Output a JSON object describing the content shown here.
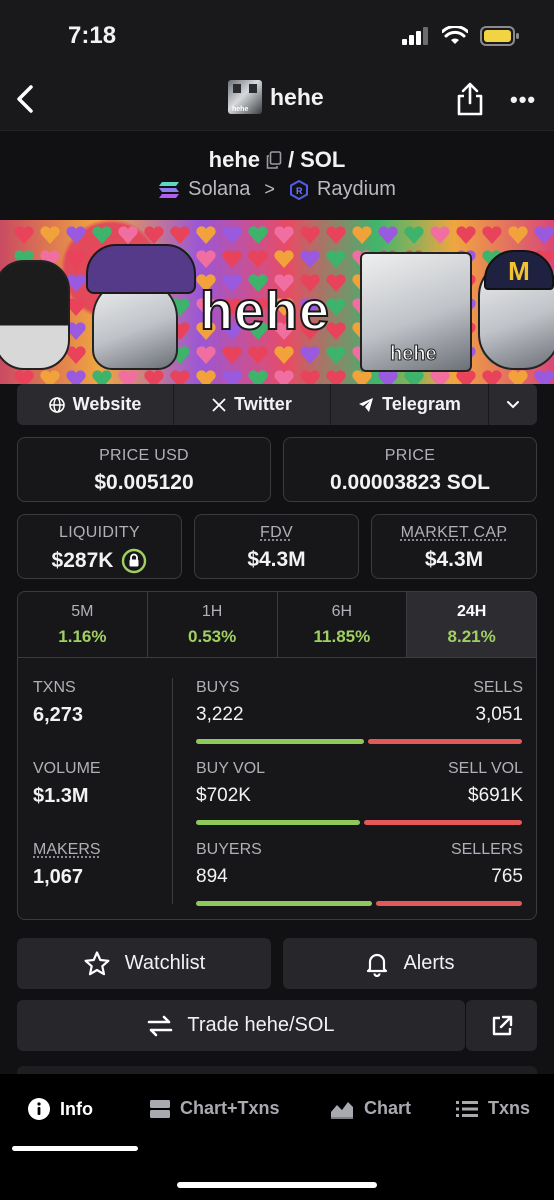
{
  "status_bar": {
    "time": "7:18"
  },
  "nav": {
    "title": "hehe",
    "avatar_caption": "hehe"
  },
  "pair": {
    "base": "hehe",
    "quote": "SOL",
    "chain": "Solana",
    "dex": "Raydium"
  },
  "banner": {
    "title": "hehe",
    "cat_caption": "hehe"
  },
  "links": [
    {
      "label": "Website",
      "icon": "globe-icon"
    },
    {
      "label": "Twitter",
      "icon": "x-logo-icon"
    },
    {
      "label": "Telegram",
      "icon": "telegram-icon"
    }
  ],
  "price_usd": {
    "label": "PRICE USD",
    "value": "$0.005120"
  },
  "price_native": {
    "label": "PRICE",
    "value": "0.00003823 SOL"
  },
  "liquidity": {
    "label": "LIQUIDITY",
    "value": "$287K"
  },
  "fdv": {
    "label": "FDV",
    "value": "$4.3M"
  },
  "market_cap": {
    "label": "MARKET CAP",
    "value": "$4.3M"
  },
  "timeframes": [
    {
      "name": "5M",
      "change": "1.16%"
    },
    {
      "name": "1H",
      "change": "0.53%"
    },
    {
      "name": "6H",
      "change": "11.85%"
    },
    {
      "name": "24H",
      "change": "8.21%",
      "active": true
    }
  ],
  "stats": {
    "txns": {
      "label": "TXNS",
      "value": "6,273",
      "left_label": "BUYS",
      "left_value": "3,222",
      "right_label": "SELLS",
      "right_value": "3,051",
      "buy_share": 0.514
    },
    "volume": {
      "label": "VOLUME",
      "value": "$1.3M",
      "left_label": "BUY VOL",
      "left_value": "$702K",
      "right_label": "SELL VOL",
      "right_value": "$691K",
      "buy_share": 0.504
    },
    "makers": {
      "label": "MAKERS",
      "value": "1,067",
      "left_label": "BUYERS",
      "left_value": "894",
      "right_label": "SELLERS",
      "right_value": "765",
      "buy_share": 0.539
    }
  },
  "actions": {
    "watchlist": "Watchlist",
    "alerts": "Alerts",
    "trade": "Trade hehe/SOL"
  },
  "bottom_nav": [
    {
      "label": "Info",
      "icon": "info-icon",
      "active": true
    },
    {
      "label": "Chart+Txns",
      "icon": "chart-txns-icon"
    },
    {
      "label": "Chart",
      "icon": "area-chart-icon"
    },
    {
      "label": "Txns",
      "icon": "list-icon"
    }
  ],
  "colors": {
    "positive": "#9fd061",
    "buy_bar": "#8fc95a",
    "sell_bar": "#e35959",
    "background": "#111114"
  }
}
